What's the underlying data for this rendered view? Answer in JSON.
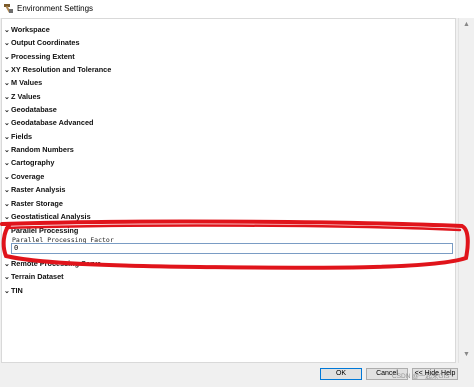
{
  "window": {
    "title": "Environment Settings",
    "icon": "hammer-icon"
  },
  "sections": [
    {
      "label": "Workspace",
      "state": "collapsed"
    },
    {
      "label": "Output Coordinates",
      "state": "collapsed"
    },
    {
      "label": "Processing Extent",
      "state": "collapsed"
    },
    {
      "label": "XY Resolution and Tolerance",
      "state": "collapsed"
    },
    {
      "label": "M Values",
      "state": "collapsed"
    },
    {
      "label": "Z Values",
      "state": "collapsed"
    },
    {
      "label": "Geodatabase",
      "state": "collapsed"
    },
    {
      "label": "Geodatabase Advanced",
      "state": "collapsed"
    },
    {
      "label": "Fields",
      "state": "collapsed"
    },
    {
      "label": "Random Numbers",
      "state": "collapsed"
    },
    {
      "label": "Cartography",
      "state": "collapsed"
    },
    {
      "label": "Coverage",
      "state": "collapsed"
    },
    {
      "label": "Raster Analysis",
      "state": "collapsed"
    },
    {
      "label": "Raster Storage",
      "state": "collapsed"
    },
    {
      "label": "Geostatistical Analysis",
      "state": "collapsed"
    },
    {
      "label": "Parallel Processing",
      "state": "expanded"
    },
    {
      "label": "Remote Processing Serve",
      "state": "collapsed"
    },
    {
      "label": "Terrain Dataset",
      "state": "collapsed"
    },
    {
      "label": "TIN",
      "state": "collapsed"
    }
  ],
  "parallel_processing": {
    "field_label": "Parallel Processing Factor",
    "value": "0"
  },
  "buttons": {
    "ok": "OK",
    "cancel": "Cancel",
    "hide_help": "<< Hide Help"
  },
  "watermark": "CSDN @一起来GIS",
  "colors": {
    "annotation": "#e0141b",
    "input_border": "#7a9cc4"
  }
}
